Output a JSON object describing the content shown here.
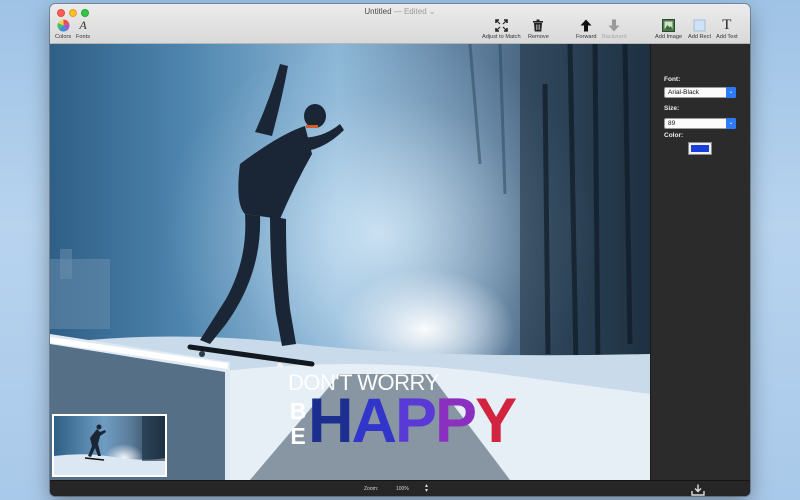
{
  "window": {
    "title": "Untitled",
    "edited": "— Edited"
  },
  "toolbar": {
    "left": [
      {
        "label": "Colors",
        "icon": "color-wheel-icon"
      },
      {
        "label": "Fonts",
        "icon": "font-italic-a-icon"
      }
    ],
    "right": [
      {
        "label": "Adjust to Match",
        "icon": "expand-arrows-icon"
      },
      {
        "label": "Remove",
        "icon": "trash-icon"
      },
      {
        "label": "Forward",
        "icon": "arrow-up-icon"
      },
      {
        "label": "Backward",
        "icon": "arrow-down-icon",
        "disabled": true
      },
      {
        "label": "Add Image",
        "icon": "image-icon"
      },
      {
        "label": "Add Rect",
        "icon": "rectangle-icon"
      },
      {
        "label": "Add Text",
        "icon": "text-T-icon"
      }
    ]
  },
  "canvas": {
    "text_line1": "DON'T WORRY",
    "text_be": [
      "B",
      "E"
    ],
    "text_happy": [
      "H",
      "A",
      "P",
      "P",
      "Y"
    ]
  },
  "inspector": {
    "font_label": "Font:",
    "font_value": "Arial-Black",
    "size_label": "Size:",
    "size_value": "89",
    "color_label": "Color:",
    "color_value": "#1a3ed8"
  },
  "bottombar": {
    "zoom_label": "Zoom:",
    "zoom_value": "100%",
    "export_icon": "download-tray-icon"
  },
  "colors": {
    "accent": "#2d7bf6",
    "sidebar": "#2b2b2b"
  }
}
